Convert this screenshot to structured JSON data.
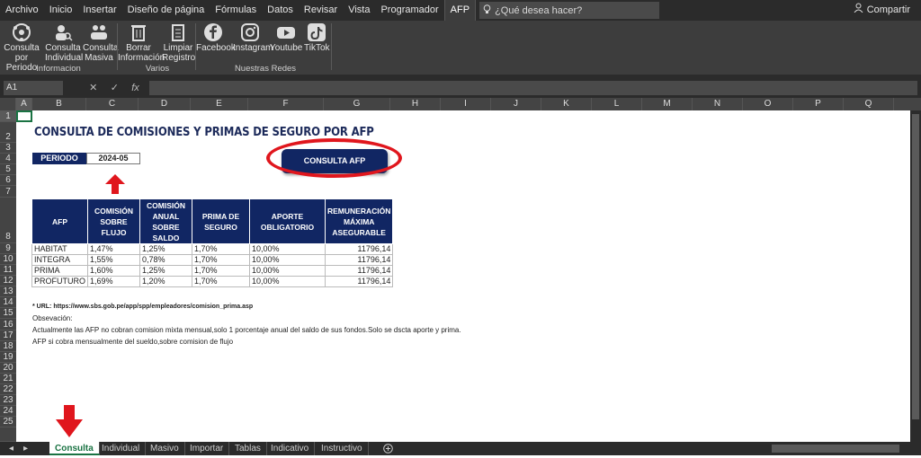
{
  "menu": {
    "items": [
      "Archivo",
      "Inicio",
      "Insertar",
      "Diseño de página",
      "Fórmulas",
      "Datos",
      "Revisar",
      "Vista",
      "Programador",
      "AFP"
    ],
    "tellme": "¿Qué desea hacer?",
    "share": "Compartir"
  },
  "ribbon": {
    "btn_periodo": [
      "Consulta",
      "por Periodo"
    ],
    "btn_individual": [
      "Consulta",
      "Individual"
    ],
    "btn_masiva": [
      "Consulta",
      "Masiva"
    ],
    "btn_borrar": [
      "Borrar",
      "Información"
    ],
    "btn_limpiar": [
      "Limpiar",
      "Registro"
    ],
    "btn_facebook": "Facebook",
    "btn_instagram": "Instagram",
    "btn_youtube": "Youtube",
    "btn_tiktok": "TikTok",
    "group_informacion": "Informacion",
    "group_varios": "Varios",
    "group_redes": "Nuestras Redes"
  },
  "formula_bar": {
    "name_box": "A1",
    "fx": "fx"
  },
  "columns": [
    "A",
    "B",
    "C",
    "D",
    "E",
    "F",
    "G",
    "H",
    "I",
    "J",
    "K",
    "L",
    "M",
    "N",
    "O",
    "P",
    "Q"
  ],
  "rows": [
    "1",
    "2",
    "3",
    "4",
    "5",
    "6",
    "7",
    "8",
    "9",
    "10",
    "11",
    "12",
    "13",
    "14",
    "15",
    "16",
    "17",
    "18",
    "19",
    "20",
    "21",
    "22",
    "23",
    "24",
    "25"
  ],
  "sheet": {
    "title": "CONSULTA DE COMISIONES Y PRIMAS DE SEGURO POR AFP",
    "periodo_label": "PERIODO",
    "periodo_value": "2024-05",
    "button": "CONSULTA AFP",
    "table": {
      "headers": [
        "AFP",
        "COMISIÓN SOBRE FLUJO",
        "COMISIÓN ANUAL SOBRE SALDO",
        "PRIMA DE SEGURO",
        "APORTE OBLIGATORIO",
        "REMUNERACIÓN MÁXIMA ASEGURABLE"
      ],
      "rows": [
        [
          "HABITAT",
          "1,47%",
          "1,25%",
          "1,70%",
          "10,00%",
          "11796,14"
        ],
        [
          "INTEGRA",
          "1,55%",
          "0,78%",
          "1,70%",
          "10,00%",
          "11796,14"
        ],
        [
          "PRIMA",
          "1,60%",
          "1,25%",
          "1,70%",
          "10,00%",
          "11796,14"
        ],
        [
          "PROFUTURO",
          "1,69%",
          "1,20%",
          "1,70%",
          "10,00%",
          "11796,14"
        ]
      ]
    },
    "url_note": "* URL: https://www.sbs.gob.pe/app/spp/empleadores/comision_prima.asp",
    "obs_label": "Obsevación:",
    "obs_line1": "Actualmente las AFP no cobran comision mixta mensual,solo 1 porcentaje anual del saldo de  sus fondos.Solo se dscta aporte y prima.",
    "obs_line2": "AFP si cobra mensualmente del sueldo,sobre comision de flujo"
  },
  "tabs": [
    "Consulta",
    "Individual",
    "Masivo",
    "Importar",
    "Tablas",
    "Indicativo",
    "Instructivo"
  ],
  "colors": {
    "navy": "#112663",
    "ring": "#e0161d",
    "arrow": "#e0161d",
    "active_tab": "#1a7343"
  }
}
